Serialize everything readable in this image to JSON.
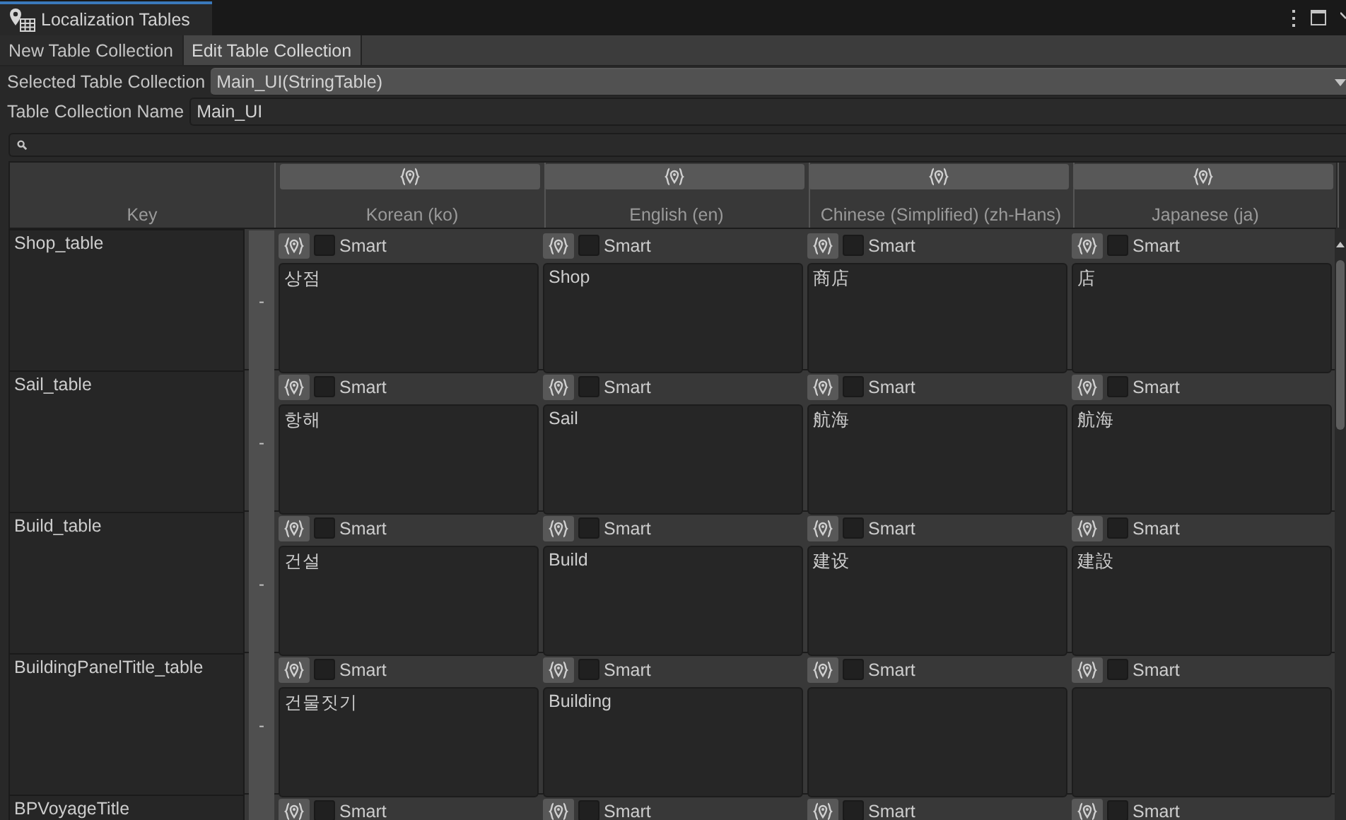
{
  "window": {
    "title": "Localization Tables"
  },
  "toolbar_tabs": [
    {
      "label": "New Table Collection",
      "selected": false
    },
    {
      "label": "Edit Table Collection",
      "selected": true
    }
  ],
  "selected_table_collection": {
    "label": "Selected Table Collection",
    "value": "Main_UI(StringTable)"
  },
  "table_collection_name": {
    "label": "Table Collection Name",
    "value": "Main_UI"
  },
  "table": {
    "key_header": "Key",
    "columns": [
      "Korean (ko)",
      "English (en)",
      "Chinese (Simplified) (zh-Hans)",
      "Japanese (ja)"
    ],
    "rows": [
      {
        "key": "Shop_table",
        "remove_label": "-",
        "cells": [
          {
            "smart": false,
            "smart_label": "Smart",
            "value": "상점"
          },
          {
            "smart": false,
            "smart_label": "Smart",
            "value": "Shop"
          },
          {
            "smart": false,
            "smart_label": "Smart",
            "value": "商店"
          },
          {
            "smart": false,
            "smart_label": "Smart",
            "value": "店"
          }
        ]
      },
      {
        "key": "Sail_table",
        "remove_label": "-",
        "cells": [
          {
            "smart": false,
            "smart_label": "Smart",
            "value": "항해"
          },
          {
            "smart": false,
            "smart_label": "Smart",
            "value": "Sail"
          },
          {
            "smart": false,
            "smart_label": "Smart",
            "value": "航海"
          },
          {
            "smart": false,
            "smart_label": "Smart",
            "value": "航海"
          }
        ]
      },
      {
        "key": "Build_table",
        "remove_label": "-",
        "cells": [
          {
            "smart": false,
            "smart_label": "Smart",
            "value": "건설"
          },
          {
            "smart": false,
            "smart_label": "Smart",
            "value": "Build"
          },
          {
            "smart": false,
            "smart_label": "Smart",
            "value": "建设"
          },
          {
            "smart": false,
            "smart_label": "Smart",
            "value": "建設"
          }
        ]
      },
      {
        "key": "BuildingPanelTitle_table",
        "remove_label": "-",
        "cells": [
          {
            "smart": false,
            "smart_label": "Smart",
            "value": "건물짓기"
          },
          {
            "smart": false,
            "smart_label": "Smart",
            "value": "Building"
          },
          {
            "smart": false,
            "smart_label": "Smart"
          },
          {
            "smart": false,
            "smart_label": "Smart"
          }
        ]
      },
      {
        "key": "BPVoyageTitle",
        "cells": [
          {
            "smart": false,
            "smart_label": "Smart"
          },
          {
            "smart": false,
            "smart_label": "Smart"
          },
          {
            "smart": false,
            "smart_label": "Smart"
          },
          {
            "smart": false,
            "smart_label": "Smart"
          }
        ]
      }
    ]
  }
}
